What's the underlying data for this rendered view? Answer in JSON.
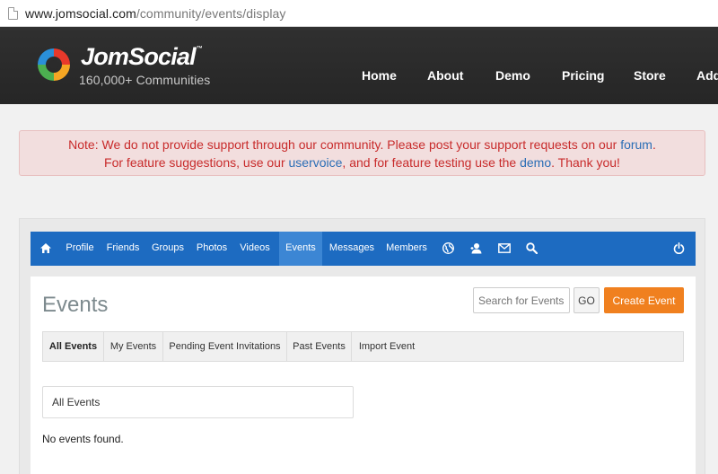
{
  "browser": {
    "url_host": "www.jomsocial.com",
    "url_path": "/community/events/display",
    "page_icon": "page-icon"
  },
  "site": {
    "brand": "JomSocial",
    "trademark": "™",
    "tagline": "160,000+ Communities",
    "logo_icon": "swirl-logo-icon",
    "nav": [
      {
        "label": "Home"
      },
      {
        "label": "About"
      },
      {
        "label": "Demo"
      },
      {
        "label": "Pricing"
      },
      {
        "label": "Store"
      },
      {
        "label": "Add"
      }
    ]
  },
  "notice": {
    "note_label": "Note:",
    "line1_text": " We do not provide support through our community. Please post your support requests on our ",
    "line1_link": "forum",
    "line1_end": ".",
    "line2_start": "For feature suggestions, use our ",
    "line2_link1": "uservoice",
    "line2_mid": ", and for feature testing use the ",
    "line2_link2": "demo",
    "line2_end": ". Thank you!",
    "colors": {
      "background": "#f2dede",
      "text": "#c82b2b",
      "link": "#2a6db5"
    }
  },
  "toolbar": {
    "color": "#1d6bc1",
    "active_color": "#3c86d4",
    "home_icon": "home-icon",
    "items": [
      {
        "label": "Profile"
      },
      {
        "label": "Friends"
      },
      {
        "label": "Groups"
      },
      {
        "label": "Photos"
      },
      {
        "label": "Videos"
      },
      {
        "label": "Events",
        "active": true
      },
      {
        "label": "Messages"
      },
      {
        "label": "Members"
      }
    ],
    "icons": [
      "globe-icon",
      "friend-request-icon",
      "mail-icon",
      "search-icon"
    ],
    "logout_icon": "power-icon"
  },
  "main": {
    "title": "Events",
    "search_placeholder": "Search for Events",
    "go_label": "GO",
    "create_label": "Create Event",
    "create_color": "#f0801f",
    "tabs": [
      {
        "label": "All Events",
        "active": true
      },
      {
        "label": "My Events"
      },
      {
        "label": "Pending Event Invitations"
      },
      {
        "label": "Past Events"
      },
      {
        "label": "Import Event"
      }
    ],
    "filter_label": "All Events",
    "empty_message": "No events found."
  }
}
